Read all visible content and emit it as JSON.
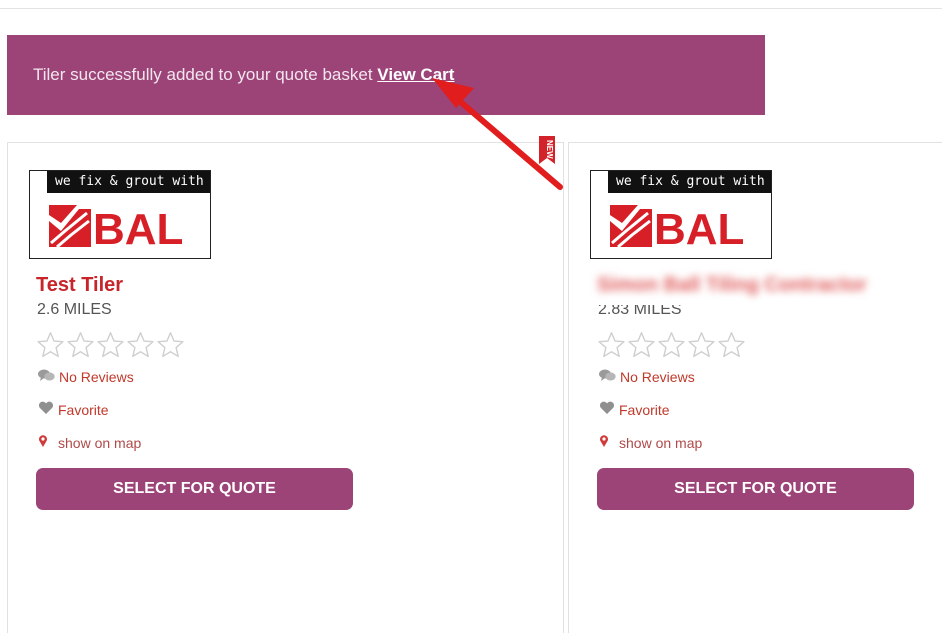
{
  "notice": {
    "message": "Tiler successfully added to your quote basket ",
    "link_label": "View Cart"
  },
  "new_badge": "NEW",
  "cards": [
    {
      "logo_tagline": "we fix & grout with",
      "logo_brand": "BAL",
      "name": "Test Tiler",
      "distance": "2.6 MILES",
      "rating": 0,
      "reviews_label": "No Reviews",
      "favorite_label": "Favorite",
      "map_label": "show on map",
      "select_label": "SELECT FOR QUOTE"
    },
    {
      "logo_tagline": "we fix & grout with",
      "logo_brand": "BAL",
      "name": "Simon Ball Tiling Contractor",
      "distance": "2.83 MILES",
      "rating": 0,
      "reviews_label": "No Reviews",
      "favorite_label": "Favorite",
      "map_label": "show on map",
      "select_label": "SELECT FOR QUOTE"
    }
  ],
  "colors": {
    "accent": "#9c4478",
    "name_red": "#c8252b",
    "bal_red": "#d71f27"
  }
}
